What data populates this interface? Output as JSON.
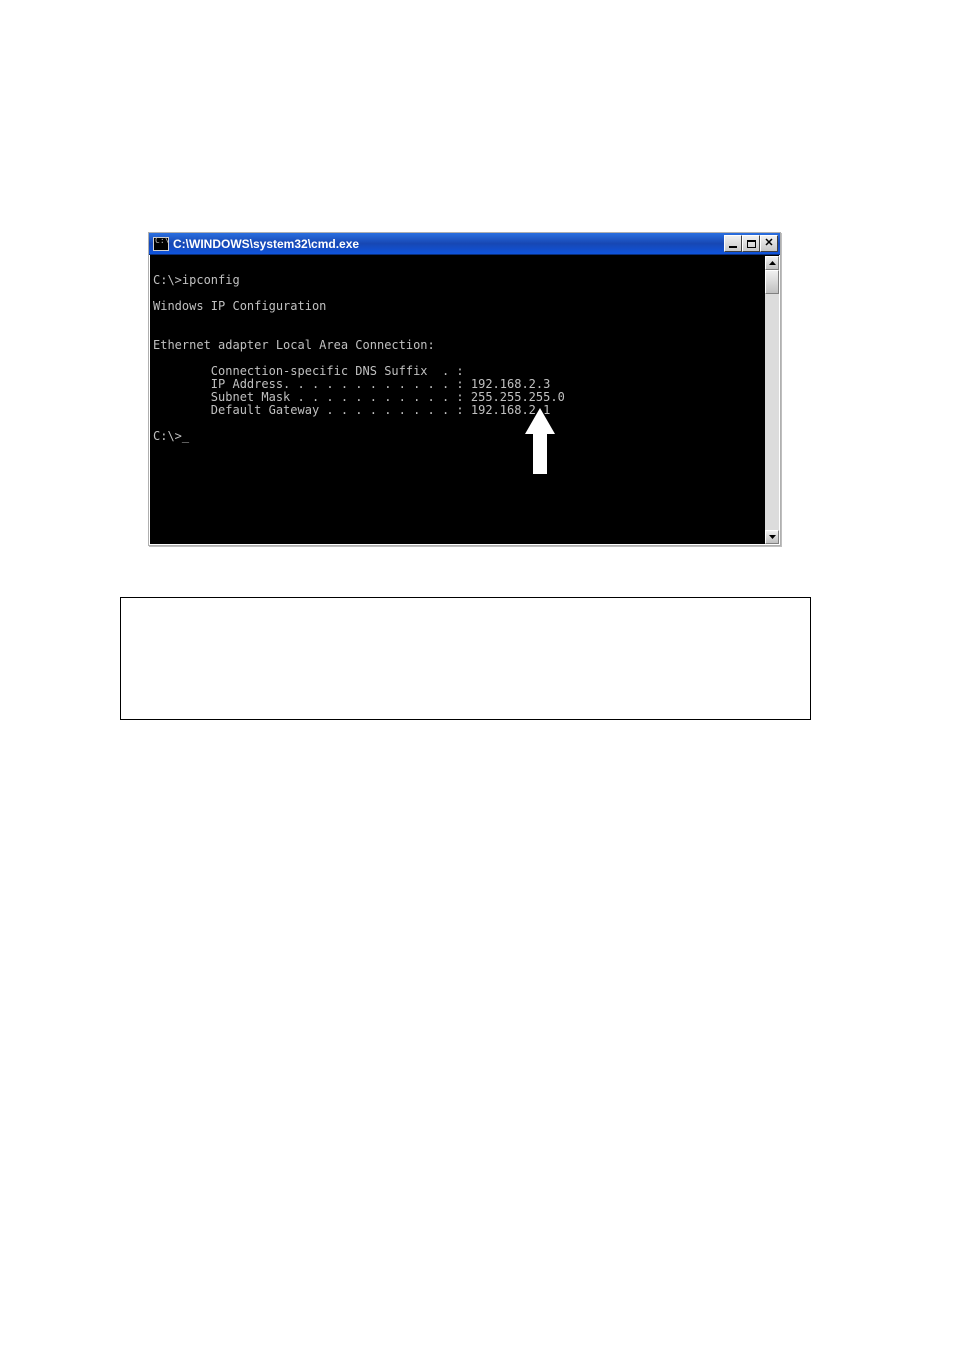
{
  "window": {
    "title": "C:\\WINDOWS\\system32\\cmd.exe",
    "icon_label": "C:\\"
  },
  "terminal": {
    "prompt_cmd": "C:\\>ipconfig",
    "blank1": "",
    "heading": "Windows IP Configuration",
    "blank2": "",
    "blank3": "",
    "adapter": "Ethernet adapter Local Area Connection:",
    "blank4": "",
    "dns": "        Connection-specific DNS Suffix  . :",
    "ip": "        IP Address. . . . . . . . . . . . : 192.168.2.3",
    "mask": "        Subnet Mask . . . . . . . . . . . : 255.255.255.0",
    "gateway": "        Default Gateway . . . . . . . . . : 192.168.2.1",
    "blank5": "",
    "prompt_idle": "C:\\>_"
  }
}
